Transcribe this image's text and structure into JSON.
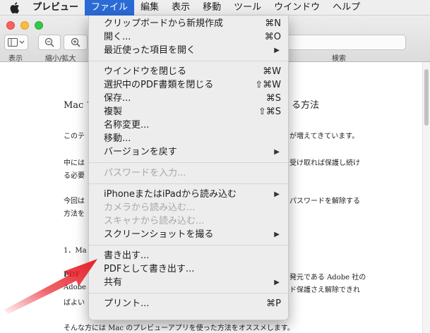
{
  "menubar": {
    "items": [
      "プレビュー",
      "ファイル",
      "編集",
      "表示",
      "移動",
      "ツール",
      "ウインドウ",
      "ヘルプ"
    ]
  },
  "toolbar": {
    "labels": {
      "view": "表示",
      "zoom": "縮小/拡大",
      "search": "検索"
    }
  },
  "document": {
    "heading_left": "Mac で",
    "heading_right": "る方法",
    "lines": [
      {
        "left": "このテ",
        "right": "が増えてきています。"
      },
      {
        "left": "中には",
        "right": "受け取れば保護し続け"
      },
      {
        "left": "る必要",
        "right": ""
      },
      {
        "left": "今回は",
        "right": "パスワードを解除する"
      },
      {
        "left": "方法を",
        "right": ""
      },
      {
        "left": "1．Ma",
        "right": ""
      },
      {
        "left": "PDF",
        "right": "発元である Adobe 社の"
      },
      {
        "left": "Adobe",
        "right": "ド保護さえ解除できれ"
      },
      {
        "left": "ばよい",
        "right": ""
      }
    ],
    "bottom_line": "そんな方には Mac のプレビューアプリを使った方法をオススメします。"
  },
  "file_menu": {
    "groups": [
      [
        {
          "label": "クリップボードから新規作成",
          "shortcut": "⌘N"
        },
        {
          "label": "開く...",
          "shortcut": "⌘O"
        },
        {
          "label": "最近使った項目を開く",
          "submenu": true
        }
      ],
      [
        {
          "label": "ウインドウを閉じる",
          "shortcut": "⌘W"
        },
        {
          "label": "選択中のPDF書類を閉じる",
          "shortcut": "⇧⌘W"
        },
        {
          "label": "保存...",
          "shortcut": "⌘S"
        },
        {
          "label": "複製",
          "shortcut": "⇧⌘S"
        },
        {
          "label": "名称変更..."
        },
        {
          "label": "移動..."
        },
        {
          "label": "バージョンを戻す",
          "submenu": true
        }
      ],
      [
        {
          "label": "パスワードを入力...",
          "disabled": true
        }
      ],
      [
        {
          "label": "iPhoneまたはiPadから読み込む",
          "submenu": true
        },
        {
          "label": "カメラから読み込む...",
          "disabled": true
        },
        {
          "label": "スキャナから読み込む...",
          "disabled": true
        },
        {
          "label": "スクリーンショットを撮る",
          "submenu": true
        }
      ],
      [
        {
          "label": "書き出す..."
        },
        {
          "label": "PDFとして書き出す..."
        },
        {
          "label": "共有",
          "submenu": true
        }
      ],
      [
        {
          "label": "プリント...",
          "shortcut": "⌘P"
        }
      ]
    ]
  },
  "colors": {
    "menu_highlight": "#2b6bd6",
    "arrow": "#e8202a"
  }
}
